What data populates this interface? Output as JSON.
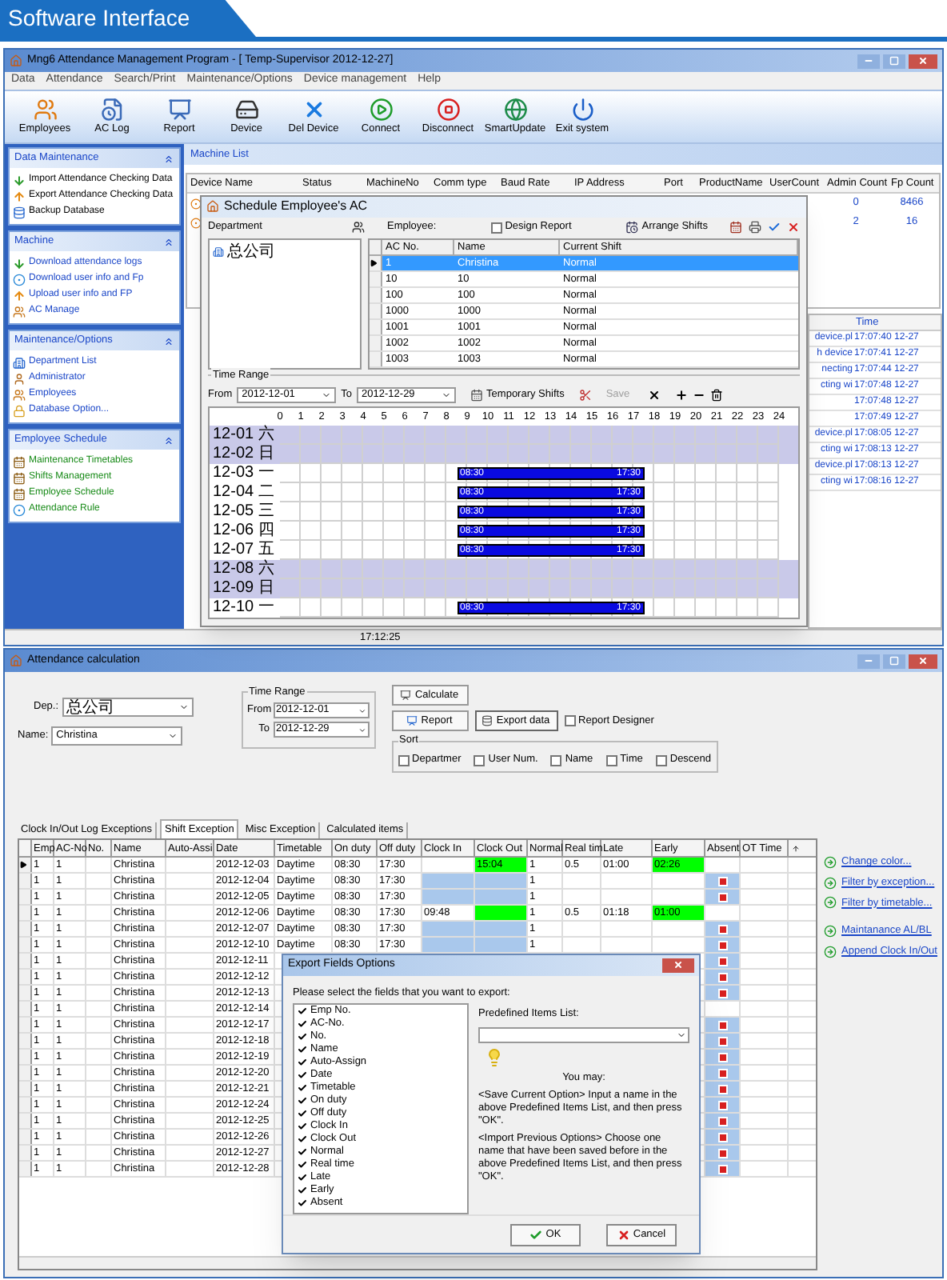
{
  "banner": {
    "title": "Software Interface"
  },
  "main_window": {
    "title": "Mng6 Attendance Management Program - [ Temp-Supervisor 2012-12-27]",
    "menu": [
      "Data",
      "Attendance",
      "Search/Print",
      "Maintenance/Options",
      "Device management",
      "Help"
    ],
    "toolbar": [
      {
        "label": "Employees",
        "kind": "people"
      },
      {
        "label": "AC Log",
        "kind": "log"
      },
      {
        "label": "Report",
        "kind": "report"
      },
      {
        "label": "Device",
        "kind": "device"
      },
      {
        "label": "Del Device",
        "kind": "delete"
      },
      {
        "label": "Connect",
        "kind": "connect"
      },
      {
        "label": "Disconnect",
        "kind": "disconnect"
      },
      {
        "label": "SmartUpdate",
        "kind": "update"
      },
      {
        "label": "Exit system",
        "kind": "exit"
      }
    ],
    "sidebar": [
      {
        "title": "Data Maintenance",
        "color": "#000000",
        "items": [
          {
            "label": "Import Attendance Checking Data",
            "kind": "down"
          },
          {
            "label": "Export Attendance Checking Data",
            "kind": "up"
          },
          {
            "label": "Backup Database",
            "kind": "database"
          }
        ]
      },
      {
        "title": "Machine",
        "color": "#1a46c8",
        "items": [
          {
            "label": "Download attendance logs",
            "kind": "down"
          },
          {
            "label": "Download user info and Fp",
            "kind": "circle"
          },
          {
            "label": "Upload user info and FP",
            "kind": "up"
          },
          {
            "label": "AC Manage",
            "kind": "people"
          }
        ]
      },
      {
        "title": "Maintenance/Options",
        "color": "#1a46c8",
        "items": [
          {
            "label": "Department List",
            "kind": "building"
          },
          {
            "label": "Administrator",
            "kind": "person"
          },
          {
            "label": "Employees",
            "kind": "people"
          },
          {
            "label": "Database Option...",
            "kind": "lock"
          }
        ]
      },
      {
        "title": "Employee Schedule",
        "color": "#178a17",
        "items": [
          {
            "label": "Maintenance Timetables",
            "kind": "calendar"
          },
          {
            "label": "Shifts Management",
            "kind": "calendar"
          },
          {
            "label": "Employee Schedule",
            "kind": "calendar"
          },
          {
            "label": "Attendance Rule",
            "kind": "circle"
          }
        ]
      }
    ],
    "machine_list": {
      "tab": "Machine List",
      "columns": [
        "Device Name",
        "Status",
        "MachineNo",
        "Comm type",
        "Baud Rate",
        "IP Address",
        "Port",
        "ProductName",
        "UserCount",
        "Admin Count",
        "Fp Count"
      ],
      "rows": [
        {
          "admin_count": "0",
          "fp_count": "8466"
        },
        {
          "admin_count": "2",
          "fp_count": "16"
        }
      ]
    },
    "log": {
      "columns": [
        "Time"
      ],
      "rows": [
        {
          "event": "device.pl",
          "time": "17:07:40 12-27"
        },
        {
          "event": "h device",
          "time": "17:07:41 12-27"
        },
        {
          "event": "necting",
          "time": "17:07:44 12-27"
        },
        {
          "event": "cting wi",
          "time": "17:07:48 12-27"
        },
        {
          "time": "17:07:48 12-27"
        },
        {
          "time": "17:07:49 12-27"
        },
        {
          "event": "device.pl",
          "time": "17:08:05 12-27"
        },
        {
          "event": "cting wi",
          "time": "17:08:13 12-27"
        },
        {
          "event": "device.pl",
          "time": "17:08:13 12-27"
        },
        {
          "event": "cting wi",
          "time": "17:08:16 12-27"
        }
      ]
    },
    "status_bar": {
      "time": "17:12:25"
    }
  },
  "schedule_dialog": {
    "title": "Schedule Employee's AC",
    "department_label": "Department",
    "departments": [
      "总公司"
    ],
    "employee_label": "Employee:",
    "design_report": {
      "label": "Design Report",
      "checked": false
    },
    "arrange_button": "Arrange Shifts",
    "employee_columns": [
      "AC No.",
      "Name",
      "Current Shift"
    ],
    "employees": [
      {
        "ac_no": "1",
        "name": "Christina",
        "shift": "Normal",
        "selected": true
      },
      {
        "ac_no": "10",
        "name": "10",
        "shift": "Normal",
        "selected": false
      },
      {
        "ac_no": "100",
        "name": "100",
        "shift": "Normal",
        "selected": false
      },
      {
        "ac_no": "1000",
        "name": "1000",
        "shift": "Normal",
        "selected": false
      },
      {
        "ac_no": "1001",
        "name": "1001",
        "shift": "Normal",
        "selected": false
      },
      {
        "ac_no": "1002",
        "name": "1002",
        "shift": "Normal",
        "selected": false
      },
      {
        "ac_no": "1003",
        "name": "1003",
        "shift": "Normal",
        "selected": false
      }
    ],
    "time_range": {
      "label": "Time Range",
      "from_label": "From",
      "from": "2012-12-01",
      "to_label": "To",
      "to": "2012-12-29"
    },
    "temporary_button": "Temporary Shifts",
    "save": {
      "label": "Save",
      "disabled": true
    },
    "hours": [
      "0",
      "1",
      "2",
      "3",
      "4",
      "5",
      "6",
      "7",
      "8",
      "9",
      "10",
      "11",
      "12",
      "13",
      "14",
      "15",
      "16",
      "17",
      "18",
      "19",
      "20",
      "21",
      "22",
      "23",
      "24"
    ],
    "days": [
      {
        "label": "12-01 六",
        "weekend": true
      },
      {
        "label": "12-02 日",
        "weekend": true
      },
      {
        "label": "12-03 一",
        "weekend": false,
        "start": "08:30",
        "end": "17:30"
      },
      {
        "label": "12-04 二",
        "weekend": false,
        "start": "08:30",
        "end": "17:30"
      },
      {
        "label": "12-05 三",
        "weekend": false,
        "start": "08:30",
        "end": "17:30"
      },
      {
        "label": "12-06 四",
        "weekend": false,
        "start": "08:30",
        "end": "17:30"
      },
      {
        "label": "12-07 五",
        "weekend": false,
        "start": "08:30",
        "end": "17:30"
      },
      {
        "label": "12-08 六",
        "weekend": true
      },
      {
        "label": "12-09 日",
        "weekend": true
      },
      {
        "label": "12-10 一",
        "weekend": false,
        "start": "08:30",
        "end": "17:30"
      }
    ]
  },
  "attendance_window": {
    "title": "Attendance calculation",
    "dep_label": "Dep.:",
    "dep": "总公司",
    "name_label": "Name:",
    "name": "Christina",
    "time_range": {
      "label": "Time Range",
      "from_label": "From",
      "from": "2012-12-01",
      "to_label": "To",
      "to": "2012-12-29"
    },
    "calculate_button": "Calculate",
    "report_button": "Report",
    "export_button": "Export data",
    "report_designer": {
      "label": "Report Designer",
      "checked": false
    },
    "sort": {
      "label": "Sort",
      "options": [
        {
          "label": "Departmer",
          "checked": false
        },
        {
          "label": "User Num.",
          "checked": false
        },
        {
          "label": "Name",
          "checked": false
        },
        {
          "label": "Time",
          "checked": false
        },
        {
          "label": "Descend",
          "checked": false
        }
      ]
    },
    "tabs": [
      {
        "label": "Clock In/Out Log Exceptions",
        "selected": false
      },
      {
        "label": "Shift Exception",
        "selected": true
      },
      {
        "label": "Misc Exception",
        "selected": false
      },
      {
        "label": "Calculated items",
        "selected": false
      }
    ],
    "columns": [
      "Emp",
      "AC-No",
      "No.",
      "Name",
      "Auto-Assi",
      "Date",
      "Timetable",
      "On duty",
      "Off duty",
      "Clock In",
      "Clock Out",
      "Normal",
      "Real tim",
      "Late",
      "Early",
      "Absent",
      "OT Time"
    ],
    "rows": [
      {
        "emp": "1",
        "ac_no": "1",
        "name": "Christina",
        "date": "2012-12-03",
        "timetable": "Daytime",
        "on_duty": "08:30",
        "off_duty": "17:30",
        "clock_out": "15:04",
        "normal": "1",
        "real_time": "0.5",
        "late": "01:00",
        "early": "02:26",
        "absent": false,
        "selected": true
      },
      {
        "emp": "1",
        "ac_no": "1",
        "name": "Christina",
        "date": "2012-12-04",
        "timetable": "Daytime",
        "on_duty": "08:30",
        "off_duty": "17:30",
        "normal": "1",
        "absent": true,
        "selected": false
      },
      {
        "emp": "1",
        "ac_no": "1",
        "name": "Christina",
        "date": "2012-12-05",
        "timetable": "Daytime",
        "on_duty": "08:30",
        "off_duty": "17:30",
        "normal": "1",
        "absent": true,
        "selected": false
      },
      {
        "emp": "1",
        "ac_no": "1",
        "name": "Christina",
        "date": "2012-12-06",
        "timetable": "Daytime",
        "on_duty": "08:30",
        "off_duty": "17:30",
        "clock_in": "09:48",
        "normal": "1",
        "real_time": "0.5",
        "late": "01:18",
        "early": "01:00",
        "absent": false,
        "selected": false
      },
      {
        "emp": "1",
        "ac_no": "1",
        "name": "Christina",
        "date": "2012-12-07",
        "timetable": "Daytime",
        "on_duty": "08:30",
        "off_duty": "17:30",
        "normal": "1",
        "absent": true,
        "selected": false
      },
      {
        "emp": "1",
        "ac_no": "1",
        "name": "Christina",
        "date": "2012-12-10",
        "timetable": "Daytime",
        "on_duty": "08:30",
        "off_duty": "17:30",
        "normal": "1",
        "absent": true,
        "selected": false
      },
      {
        "emp": "1",
        "ac_no": "1",
        "name": "Christina",
        "date": "2012-12-11",
        "absent": true,
        "selected": false
      },
      {
        "emp": "1",
        "ac_no": "1",
        "name": "Christina",
        "date": "2012-12-12",
        "absent": true,
        "selected": false
      },
      {
        "emp": "1",
        "ac_no": "1",
        "name": "Christina",
        "date": "2012-12-13",
        "absent": true,
        "selected": false
      },
      {
        "emp": "1",
        "ac_no": "1",
        "name": "Christina",
        "date": "2012-12-14",
        "absent": false,
        "selected": false
      },
      {
        "emp": "1",
        "ac_no": "1",
        "name": "Christina",
        "date": "2012-12-17",
        "absent": true,
        "selected": false
      },
      {
        "emp": "1",
        "ac_no": "1",
        "name": "Christina",
        "date": "2012-12-18",
        "absent": true,
        "selected": false
      },
      {
        "emp": "1",
        "ac_no": "1",
        "name": "Christina",
        "date": "2012-12-19",
        "absent": true,
        "selected": false
      },
      {
        "emp": "1",
        "ac_no": "1",
        "name": "Christina",
        "date": "2012-12-20",
        "absent": true,
        "selected": false
      },
      {
        "emp": "1",
        "ac_no": "1",
        "name": "Christina",
        "date": "2012-12-21",
        "absent": true,
        "selected": false
      },
      {
        "emp": "1",
        "ac_no": "1",
        "name": "Christina",
        "date": "2012-12-24",
        "absent": true,
        "selected": false
      },
      {
        "emp": "1",
        "ac_no": "1",
        "name": "Christina",
        "date": "2012-12-25",
        "absent": true,
        "selected": false
      },
      {
        "emp": "1",
        "ac_no": "1",
        "name": "Christina",
        "date": "2012-12-26",
        "absent": true,
        "selected": false
      },
      {
        "emp": "1",
        "ac_no": "1",
        "name": "Christina",
        "date": "2012-12-27",
        "absent": true,
        "selected": false
      },
      {
        "emp": "1",
        "ac_no": "1",
        "name": "Christina",
        "date": "2012-12-28",
        "absent": true,
        "selected": false
      }
    ],
    "links": [
      [
        "Change color...",
        "Filter by exception...",
        "Filter by timetable..."
      ],
      [
        "Maintanance AL/BL",
        "Append Clock In/Out"
      ]
    ]
  },
  "export_dialog": {
    "title": "Export Fields Options",
    "prompt": "Please select the fields that you want to export:",
    "fields": [
      {
        "label": "Emp No.",
        "checked": true
      },
      {
        "label": "AC-No.",
        "checked": true
      },
      {
        "label": "No.",
        "checked": true
      },
      {
        "label": "Name",
        "checked": true
      },
      {
        "label": "Auto-Assign",
        "checked": true
      },
      {
        "label": "Date",
        "checked": true
      },
      {
        "label": "Timetable",
        "checked": true
      },
      {
        "label": "On duty",
        "checked": true
      },
      {
        "label": "Off duty",
        "checked": true
      },
      {
        "label": "Clock In",
        "checked": true
      },
      {
        "label": "Clock Out",
        "checked": true
      },
      {
        "label": "Normal",
        "checked": true
      },
      {
        "label": "Real time",
        "checked": true
      },
      {
        "label": "Late",
        "checked": true
      },
      {
        "label": "Early",
        "checked": true
      },
      {
        "label": "Absent",
        "checked": true
      }
    ],
    "predefined_label": "Predefined Items List:",
    "help": [
      "You may:",
      "<Save Current Option> Input a name in the above Predefined Items List, and then press \"OK\".",
      "<Import Previous Options> Choose one name that have been saved before in the above Predefined Items List, and then press \"OK\"."
    ],
    "ok_button": "OK",
    "cancel_button": "Cancel"
  }
}
